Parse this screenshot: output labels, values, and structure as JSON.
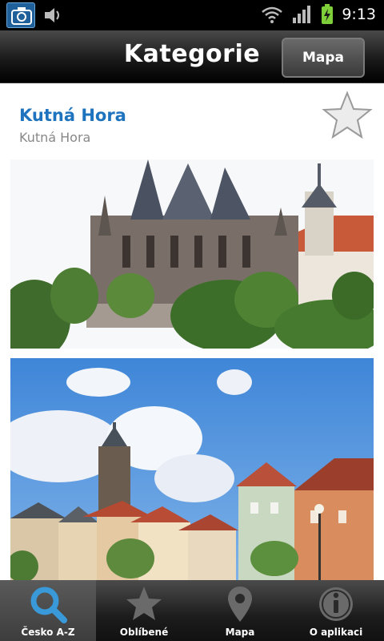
{
  "status_bar": {
    "time": "9:13",
    "icons": [
      "camera-icon",
      "volume-icon",
      "wifi-icon",
      "signal-icon",
      "battery-charging-icon"
    ]
  },
  "header": {
    "title": "Kategorie",
    "map_button_label": "Mapa"
  },
  "place": {
    "name": "Kutná Hora",
    "subtitle": "Kutná Hora",
    "favorite_icon": "star-outline-icon",
    "photos": [
      "cathedral-photo",
      "town-square-photo"
    ]
  },
  "tabs": [
    {
      "label": "Česko A-Z",
      "icon": "search-icon",
      "active": true
    },
    {
      "label": "Oblíbené",
      "icon": "star-icon",
      "active": false
    },
    {
      "label": "Mapa",
      "icon": "map-pin-icon",
      "active": false
    },
    {
      "label": "O aplikaci",
      "icon": "info-icon",
      "active": false
    }
  ],
  "colors": {
    "accent": "#1e73be",
    "header_bg": "#1a1a1a",
    "tab_active_icon": "#3a9ad9"
  }
}
